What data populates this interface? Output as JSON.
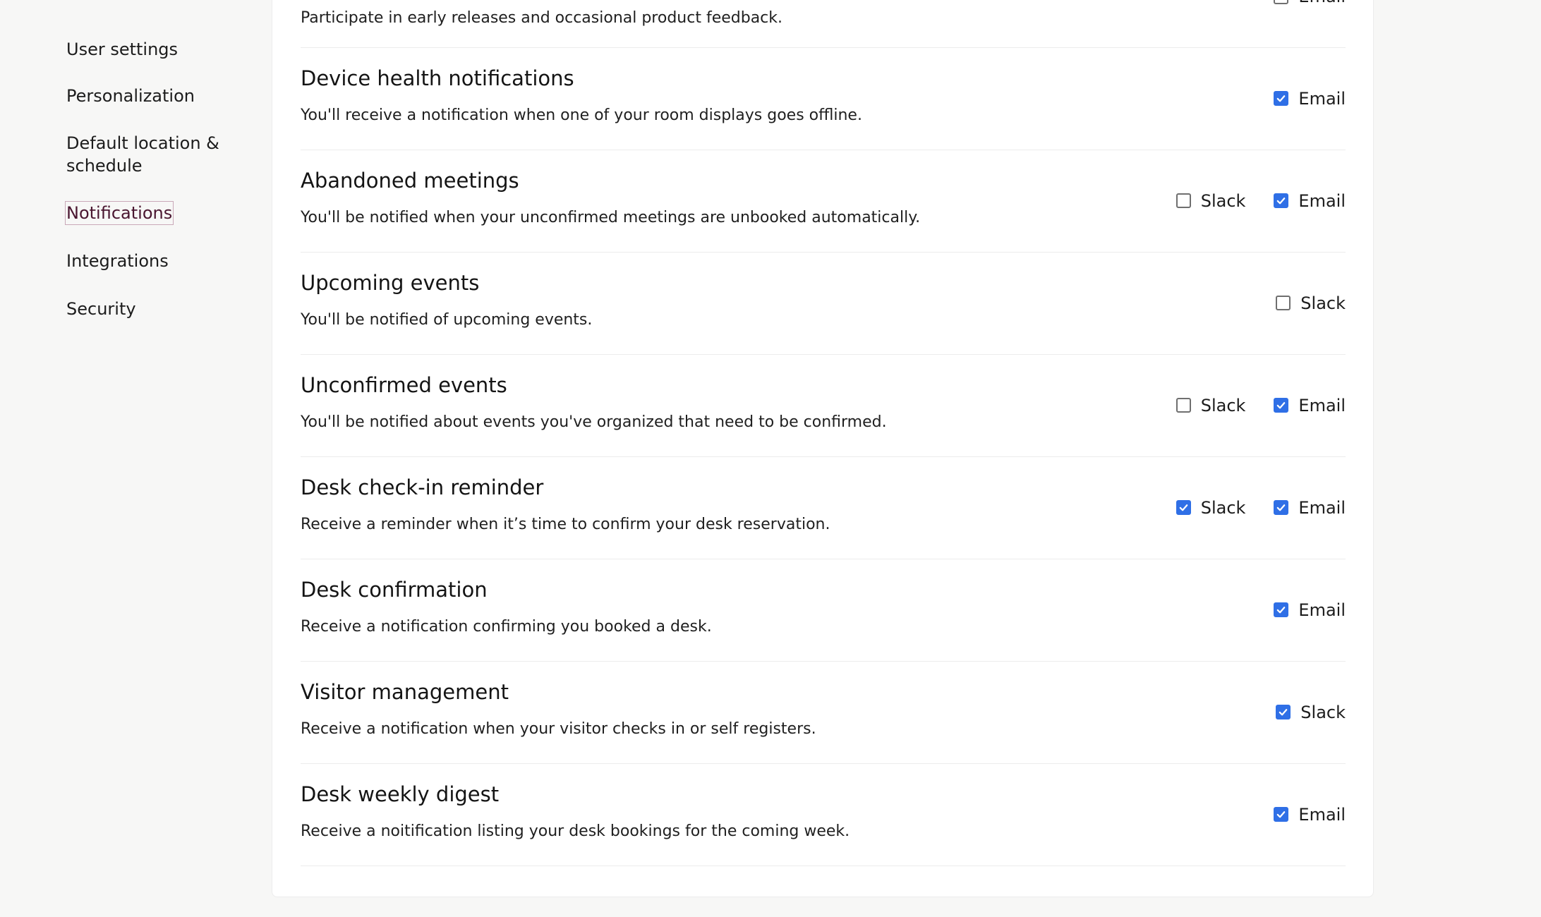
{
  "sidebar": {
    "items": [
      {
        "label": "User settings"
      },
      {
        "label": "Personalization"
      },
      {
        "label": "Default location & schedule"
      },
      {
        "label": "Notifications",
        "active": true
      },
      {
        "label": "Integrations"
      },
      {
        "label": "Security"
      }
    ]
  },
  "notifications": {
    "rows": [
      {
        "title": "",
        "description": "Participate in early releases and occasional product feedback.",
        "options": [
          {
            "label": "Email",
            "checked": false
          }
        ]
      },
      {
        "title": "Device health notifications",
        "description": "You'll receive a notification when one of your room displays goes offline.",
        "options": [
          {
            "label": "Email",
            "checked": true
          }
        ]
      },
      {
        "title": "Abandoned meetings",
        "description": "You'll be notified when your unconfirmed meetings are unbooked automatically.",
        "options": [
          {
            "label": "Slack",
            "checked": false
          },
          {
            "label": "Email",
            "checked": true
          }
        ]
      },
      {
        "title": "Upcoming events",
        "description": "You'll be notified of upcoming events.",
        "options": [
          {
            "label": "Slack",
            "checked": false
          }
        ]
      },
      {
        "title": "Unconfirmed events",
        "description": "You'll be notified about events you've organized that need to be confirmed.",
        "options": [
          {
            "label": "Slack",
            "checked": false
          },
          {
            "label": "Email",
            "checked": true
          }
        ]
      },
      {
        "title": "Desk check-in reminder",
        "description": "Receive a reminder when it’s time to confirm your desk reservation.",
        "options": [
          {
            "label": "Slack",
            "checked": true
          },
          {
            "label": "Email",
            "checked": true
          }
        ]
      },
      {
        "title": "Desk confirmation",
        "description": "Receive a notification confirming you booked a desk.",
        "options": [
          {
            "label": "Email",
            "checked": true
          }
        ]
      },
      {
        "title": "Visitor management",
        "description": "Receive a notification when your visitor checks in or self registers.",
        "options": [
          {
            "label": "Slack",
            "checked": true
          }
        ]
      },
      {
        "title": "Desk weekly digest",
        "description": "Receive a noitification listing your desk bookings for the coming week.",
        "options": [
          {
            "label": "Email",
            "checked": true
          }
        ]
      }
    ]
  },
  "colors": {
    "accent": "#2f6fe6",
    "active_nav": "#4a1630"
  }
}
